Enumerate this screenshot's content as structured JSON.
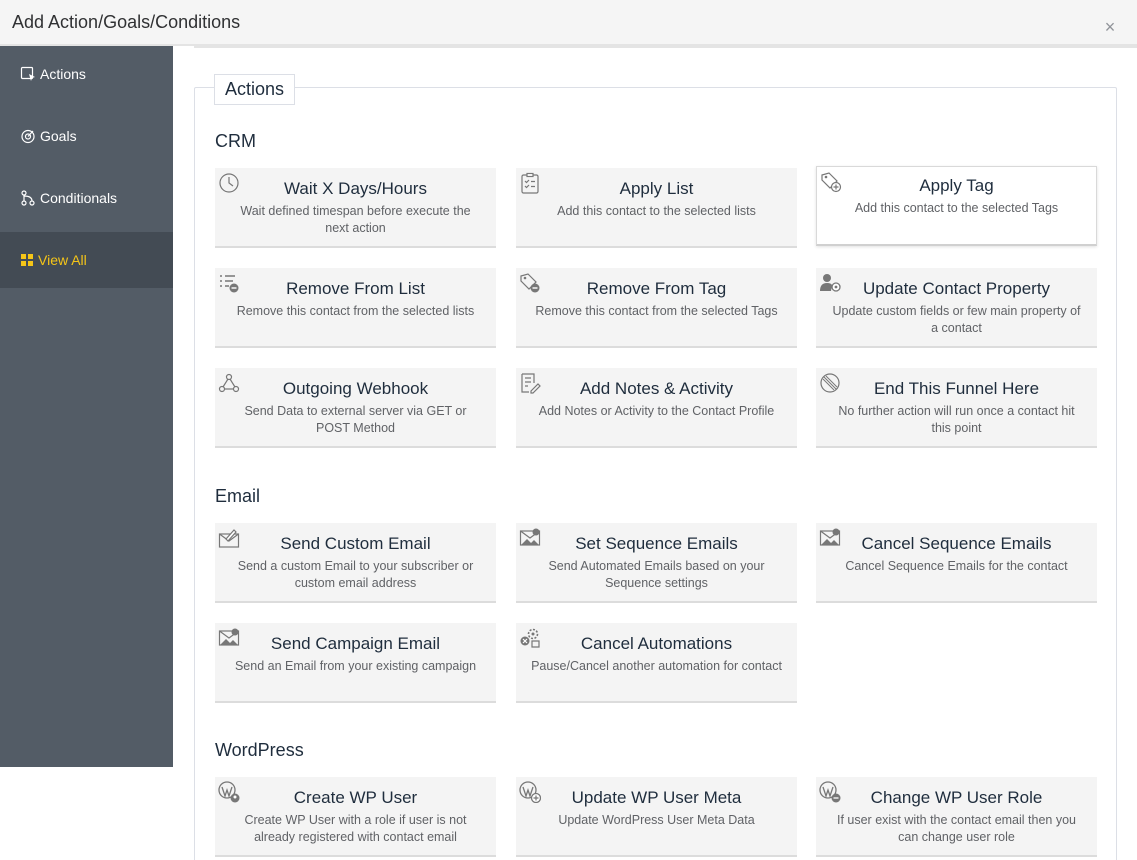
{
  "dialog": {
    "title": "Add Action/Goals/Conditions",
    "close_label": "×"
  },
  "sidebar": {
    "items": [
      {
        "label": "Actions",
        "icon": "action-icon"
      },
      {
        "label": "Goals",
        "icon": "goal-icon"
      },
      {
        "label": "Conditionals",
        "icon": "conditional-icon"
      },
      {
        "label": "View All",
        "icon": "grid-icon",
        "active": true
      }
    ]
  },
  "main": {
    "legend": "Actions",
    "sections": [
      {
        "title": "CRM",
        "cards": [
          {
            "title": "Wait X Days/Hours",
            "desc": "Wait defined timespan before execute the next action",
            "icon": "clock-icon"
          },
          {
            "title": "Apply List",
            "desc": "Add this contact to the selected lists",
            "icon": "clipboard-list-icon"
          },
          {
            "title": "Apply Tag",
            "desc": "Add this contact to the selected Tags",
            "icon": "tag-add-icon",
            "selected": true
          },
          {
            "title": "Remove From List",
            "desc": "Remove this contact from the selected lists",
            "icon": "list-remove-icon"
          },
          {
            "title": "Remove From Tag",
            "desc": "Remove this contact from the selected Tags",
            "icon": "tag-remove-icon"
          },
          {
            "title": "Update Contact Property",
            "desc": "Update custom fields or few main property of a contact",
            "icon": "user-gear-icon"
          },
          {
            "title": "Outgoing Webhook",
            "desc": "Send Data to external server via GET or POST Method",
            "icon": "webhook-icon"
          },
          {
            "title": "Add Notes & Activity",
            "desc": "Add Notes or Activity to the Contact Profile",
            "icon": "note-edit-icon"
          },
          {
            "title": "End This Funnel Here",
            "desc": "No further action will run once a contact hit this point",
            "icon": "stop-icon"
          }
        ]
      },
      {
        "title": "Email",
        "cards": [
          {
            "title": "Send Custom Email",
            "desc": "Send a custom Email to your subscriber or custom email address",
            "icon": "email-edit-icon"
          },
          {
            "title": "Set Sequence Emails",
            "desc": "Send Automated Emails based on your Sequence settings",
            "icon": "email-sequence-icon"
          },
          {
            "title": "Cancel Sequence Emails",
            "desc": "Cancel Sequence Emails for the contact",
            "icon": "email-cancel-icon"
          },
          {
            "title": "Send Campaign Email",
            "desc": "Send an Email from your existing campaign",
            "icon": "email-campaign-icon"
          },
          {
            "title": "Cancel Automations",
            "desc": "Pause/Cancel another automation for contact",
            "icon": "automation-cancel-icon"
          }
        ]
      },
      {
        "title": "WordPress",
        "cards": [
          {
            "title": "Create WP User",
            "desc": "Create WP User with a role if user is not already registered with contact email",
            "icon": "wordpress-user-icon"
          },
          {
            "title": "Update WP User Meta",
            "desc": "Update WordPress User Meta Data",
            "icon": "wordpress-meta-icon"
          },
          {
            "title": "Change WP User Role",
            "desc": "If user exist with the contact email then you can change user role",
            "icon": "wordpress-role-icon"
          }
        ]
      }
    ]
  },
  "colors": {
    "sidebar": "#535c66",
    "sidebar_active": "#434b54",
    "accent": "#f5c518",
    "card": "#f4f4f4"
  }
}
